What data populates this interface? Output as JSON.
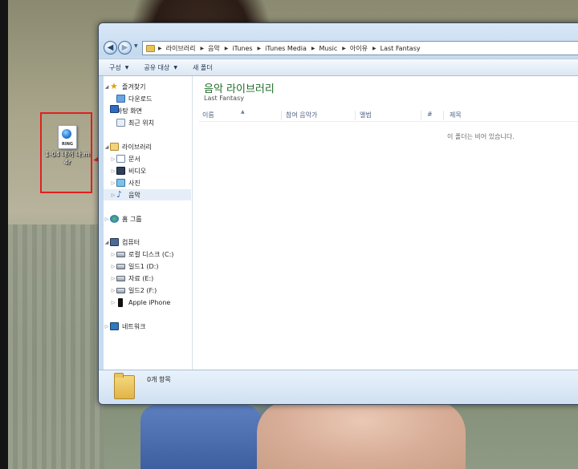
{
  "desktop": {
    "icon": {
      "badge": "RING",
      "label": "1-04 내꺼 나.m4r"
    }
  },
  "explorer": {
    "breadcrumbs": [
      "라이브러리",
      "음악",
      "iTunes",
      "iTunes Media",
      "Music",
      "아이유",
      "Last Fantasy"
    ],
    "toolbar": {
      "organize": "구성",
      "share": "공유 대상",
      "new_folder": "새 폴더"
    },
    "nav": {
      "favorites": "즐겨찾기",
      "downloads": "다운로드",
      "desktop": "바탕 화면",
      "recent": "최근 위치",
      "libraries": "라이브러리",
      "documents": "문서",
      "videos": "비디오",
      "pictures": "사진",
      "music": "음악",
      "homegroup": "홈 그룹",
      "computer": "컴퓨터",
      "drive_c": "로컬 디스크 (C:)",
      "drive_d": "일드1 (D:)",
      "drive_e": "자료 (E:)",
      "drive_f": "일드2 (F:)",
      "iphone": "Apple iPhone",
      "network": "네트워크"
    },
    "content": {
      "title": "음악 라이브러리",
      "subtitle": "Last Fantasy",
      "columns": [
        "이름",
        "참여 음악가",
        "앨범",
        "#",
        "제목"
      ],
      "empty_message": "이 폴더는 비어 있습니다."
    },
    "details": {
      "item_count": "0개 항목"
    }
  },
  "colors": {
    "annotation": "#e02020",
    "title_green": "#1f6b27"
  }
}
